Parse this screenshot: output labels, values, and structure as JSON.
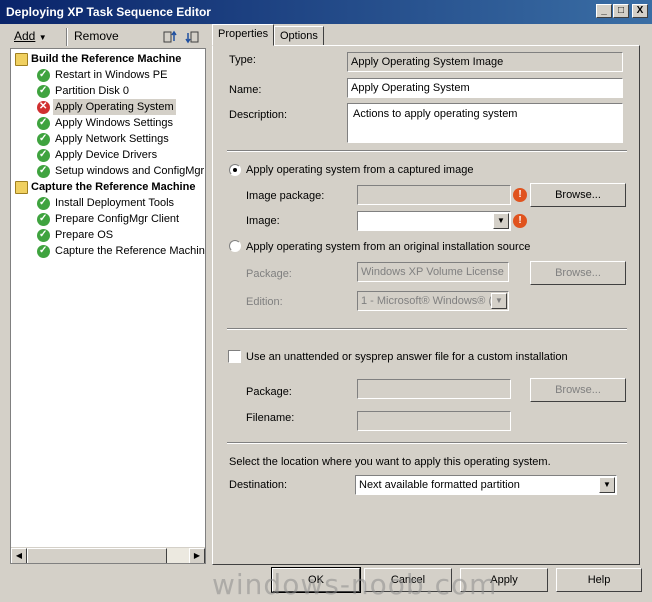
{
  "window": {
    "title": "Deploying XP Task Sequence Editor",
    "controls": [
      "_",
      "□",
      "X"
    ]
  },
  "toolbar": {
    "add_label": "Add",
    "remove_label": "Remove"
  },
  "tree": {
    "groups": [
      {
        "label": "Build the Reference Machine",
        "icon": "folder-icon",
        "items": [
          {
            "label": "Restart in Windows PE",
            "status": "ok"
          },
          {
            "label": "Partition Disk 0",
            "status": "ok"
          },
          {
            "label": "Apply Operating System",
            "status": "error",
            "selected": true
          },
          {
            "label": "Apply Windows Settings",
            "status": "ok"
          },
          {
            "label": "Apply Network Settings",
            "status": "ok"
          },
          {
            "label": "Apply Device Drivers",
            "status": "ok"
          },
          {
            "label": "Setup windows and ConfigMgr",
            "status": "ok"
          }
        ]
      },
      {
        "label": "Capture the Reference Machine",
        "icon": "folder-icon",
        "items": [
          {
            "label": "Install Deployment Tools",
            "status": "ok"
          },
          {
            "label": "Prepare ConfigMgr Client",
            "status": "ok"
          },
          {
            "label": "Prepare OS",
            "status": "ok"
          },
          {
            "label": "Capture the Reference Machine",
            "status": "ok"
          }
        ]
      }
    ]
  },
  "tabs": [
    {
      "label": "Properties",
      "active": true
    },
    {
      "label": "Options",
      "active": false
    }
  ],
  "properties": {
    "type_label": "Type:",
    "type_value": "Apply Operating System Image",
    "name_label": "Name:",
    "name_value": "Apply Operating System",
    "description_label": "Description:",
    "description_value": "Actions to apply operating system",
    "captured": {
      "radio_label": "Apply operating system from a captured image",
      "selected": true,
      "package_label": "Image package:",
      "package_value": "",
      "image_label": "Image:",
      "image_value": "",
      "browse_label": "Browse..."
    },
    "original": {
      "radio_label": "Apply operating system from an original installation source",
      "selected": false,
      "package_label": "Package:",
      "package_value": "Windows XP Volume License",
      "edition_label": "Edition:",
      "edition_value": "1 - Microsoft® Windows® (",
      "browse_label": "Browse..."
    },
    "unattend": {
      "checkbox_label": "Use an unattended or sysprep answer file for a custom installation",
      "checked": false,
      "package_label": "Package:",
      "package_value": "",
      "filename_label": "Filename:",
      "filename_value": "",
      "browse_label": "Browse..."
    },
    "location_text": "Select the location where you want to apply this operating system.",
    "destination_label": "Destination:",
    "destination_value": "Next available formatted partition"
  },
  "buttons": {
    "ok": "OK",
    "cancel": "Cancel",
    "apply": "Apply",
    "help": "Help"
  },
  "watermark": "windows-noob.com"
}
